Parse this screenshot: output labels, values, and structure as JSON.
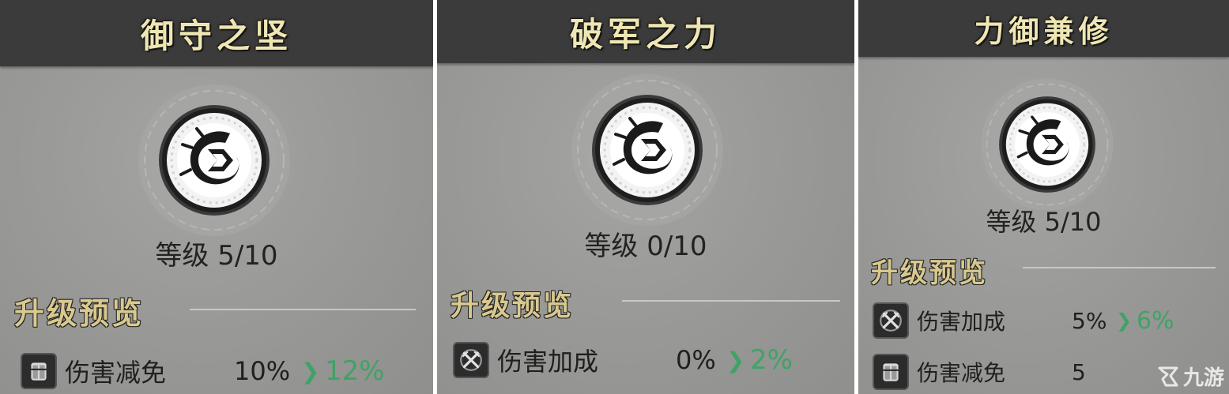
{
  "panels": [
    {
      "title": "御守之坚",
      "level": "等级 5/10",
      "section_title": "升级预览",
      "stats": [
        {
          "icon": "armor-icon",
          "name": "伤害减免",
          "from": "10%",
          "to": "12%"
        }
      ]
    },
    {
      "title": "破军之力",
      "level": "等级 0/10",
      "section_title": "升级预览",
      "stats": [
        {
          "icon": "crossed-swords-icon",
          "name": "伤害加成",
          "from": "0%",
          "to": "2%"
        }
      ]
    },
    {
      "title": "力御兼修",
      "level": "等级 5/10",
      "section_title": "升级预览",
      "stats": [
        {
          "icon": "crossed-swords-icon",
          "name": "伤害加成",
          "from": "5%",
          "to": "6%"
        },
        {
          "icon": "armor-icon",
          "name": "伤害减免",
          "from": "5",
          "to": ""
        }
      ]
    }
  ],
  "arrow_glyph": "❯",
  "watermark": {
    "text": "九游",
    "icon": "fox-logo-icon"
  },
  "colors": {
    "header_bg": "#3b3b3b",
    "title_gold": "#efe6b3",
    "section_gold": "#d9c98e",
    "increase_green": "#3fa366",
    "panel_bg": "#9a9a98"
  }
}
